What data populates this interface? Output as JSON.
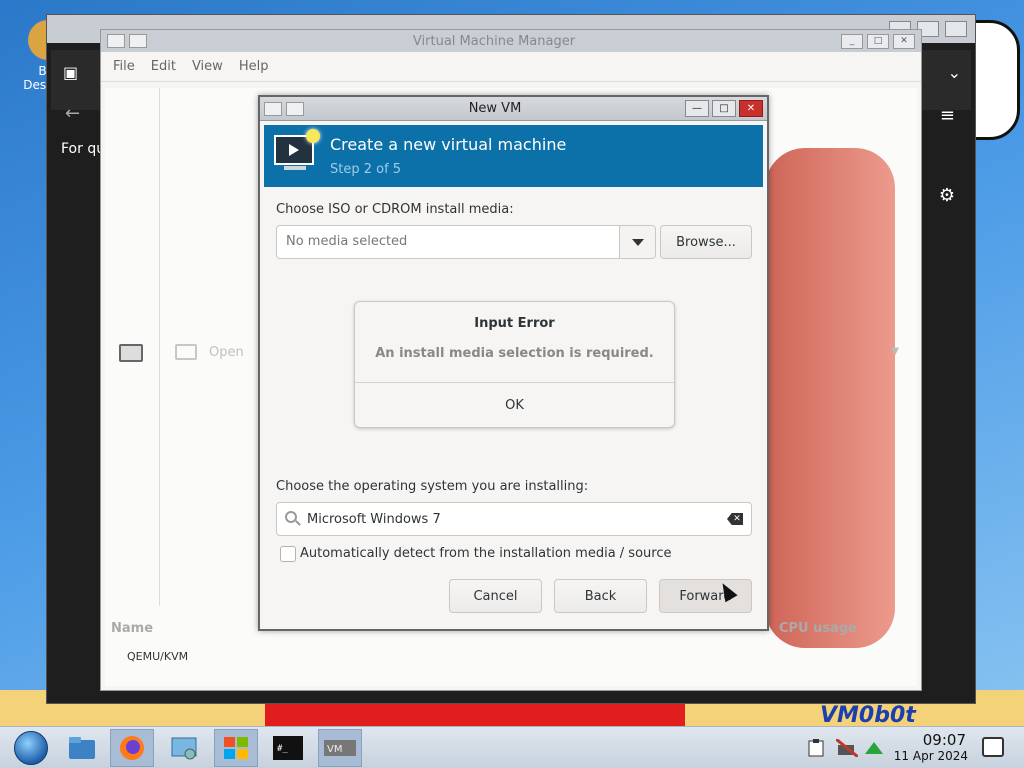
{
  "desktop": {
    "icon_label": "Big Desktop",
    "wallpaper_text": "VM0b0t"
  },
  "background_window": {
    "quick_text": "For qui"
  },
  "vmm": {
    "title": "Virtual Machine Manager",
    "menu": [
      "File",
      "Edit",
      "View",
      "Help"
    ],
    "open_label": "Open",
    "col_name": "Name",
    "col_cpu": "CPU usage",
    "connection": "QEMU/KVM"
  },
  "dialog": {
    "title": "New VM",
    "header_title": "Create a new virtual machine",
    "header_step": "Step 2 of 5",
    "media_label": "Choose ISO or CDROM install media:",
    "media_value": "No media selected",
    "browse_label": "Browse...",
    "error": {
      "title": "Input Error",
      "message": "An install media selection is required.",
      "ok_label": "OK"
    },
    "os_label": "Choose the operating system you are installing:",
    "os_value": "Microsoft Windows 7",
    "auto_detect_label": "Automatically detect from the installation media / source",
    "auto_detect_checked": false,
    "cancel_label": "Cancel",
    "back_label": "Back",
    "forward_label": "Forward"
  },
  "taskbar": {
    "time": "09:07",
    "date": "11 Apr 2024",
    "apps": [
      "start-menu",
      "file-manager",
      "firefox",
      "control-panel",
      "windows-logo",
      "terminal",
      "virt-manager"
    ]
  },
  "colors": {
    "header_blue": "#0c71a8",
    "close_red": "#c9302c"
  }
}
